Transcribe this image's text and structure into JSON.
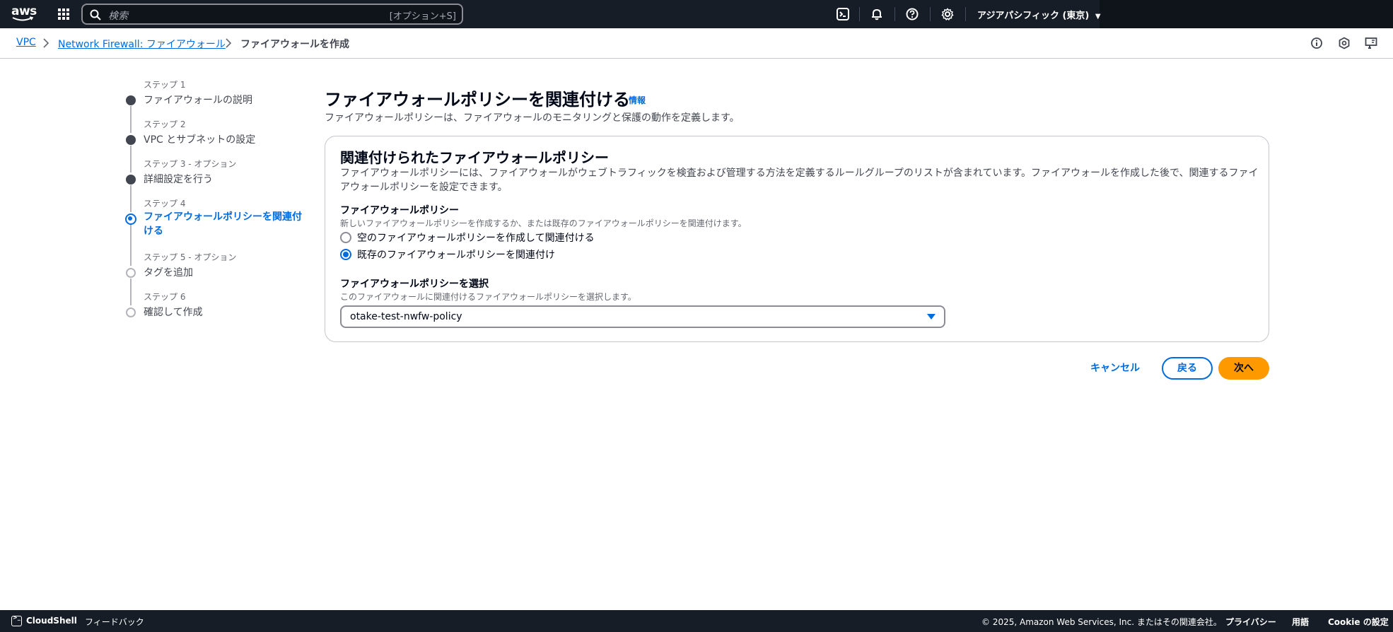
{
  "topnav": {
    "logo_text": "aws",
    "search_placeholder": "検索",
    "search_shortcut": "[オプション+S]",
    "icons": [
      "cloudshell-icon",
      "bell-icon",
      "help-icon",
      "gear-icon"
    ],
    "region_label": "アジアパシフィック (東京)"
  },
  "breadcrumb": {
    "items": [
      {
        "label": "VPC",
        "link": true
      },
      {
        "label": "Network Firewall: ファイアウォール",
        "link": true
      },
      {
        "label": "ファイアウォールを作成",
        "link": false
      }
    ]
  },
  "utility_icons": [
    "info-circle-icon",
    "settings-hexagon-icon",
    "feedback-screen-icon"
  ],
  "steps": [
    {
      "number": "ステップ 1",
      "title": "ファイアウォールの説明",
      "state": "done"
    },
    {
      "number": "ステップ 2",
      "title": "VPC とサブネットの設定",
      "state": "done"
    },
    {
      "number": "ステップ 3 - オプション",
      "title": "詳細設定を行う",
      "state": "done"
    },
    {
      "number": "ステップ 4",
      "title": "ファイアウォールポリシーを関連付ける",
      "state": "active"
    },
    {
      "number": "ステップ 5 - オプション",
      "title": "タグを追加",
      "state": "pending"
    },
    {
      "number": "ステップ 6",
      "title": "確認して作成",
      "state": "pending"
    }
  ],
  "main": {
    "title": "ファイアウォールポリシーを関連付ける",
    "info_label": "情報",
    "description": "ファイアウォールポリシーは、ファイアウォールのモニタリングと保護の動作を定義します。"
  },
  "panel": {
    "title": "関連付けられたファイアウォールポリシー",
    "description": "ファイアウォールポリシーには、ファイアウォールがウェブトラフィックを検査および管理する方法を定義するルールグループのリストが含まれています。ファイアウォールを作成した後で、関連するファイアウォールポリシーを設定できます。",
    "policy_field": {
      "label": "ファイアウォールポリシー",
      "description": "新しいファイアウォールポリシーを作成するか、または既存のファイアウォールポリシーを関連付けます。",
      "options": [
        {
          "label": "空のファイアウォールポリシーを作成して関連付ける",
          "checked": false
        },
        {
          "label": "既存のファイアウォールポリシーを関連付け",
          "checked": true
        }
      ]
    },
    "select_field": {
      "label": "ファイアウォールポリシーを選択",
      "description": "このファイアウォールに関連付けるファイアウォールポリシーを選択します。",
      "value": "otake-test-nwfw-policy"
    }
  },
  "actions": {
    "cancel": "キャンセル",
    "back": "戻る",
    "next": "次へ"
  },
  "footer": {
    "cloudshell": "CloudShell",
    "feedback": "フィードバック",
    "copyright": "© 2025, Amazon Web Services, Inc. またはその関連会社。",
    "privacy": "プライバシー",
    "terms": "用語",
    "cookie": "Cookie の設定"
  },
  "colors": {
    "nav_bg": "#161d26",
    "link": "#006ce0",
    "primary_button": "#ff9900"
  }
}
